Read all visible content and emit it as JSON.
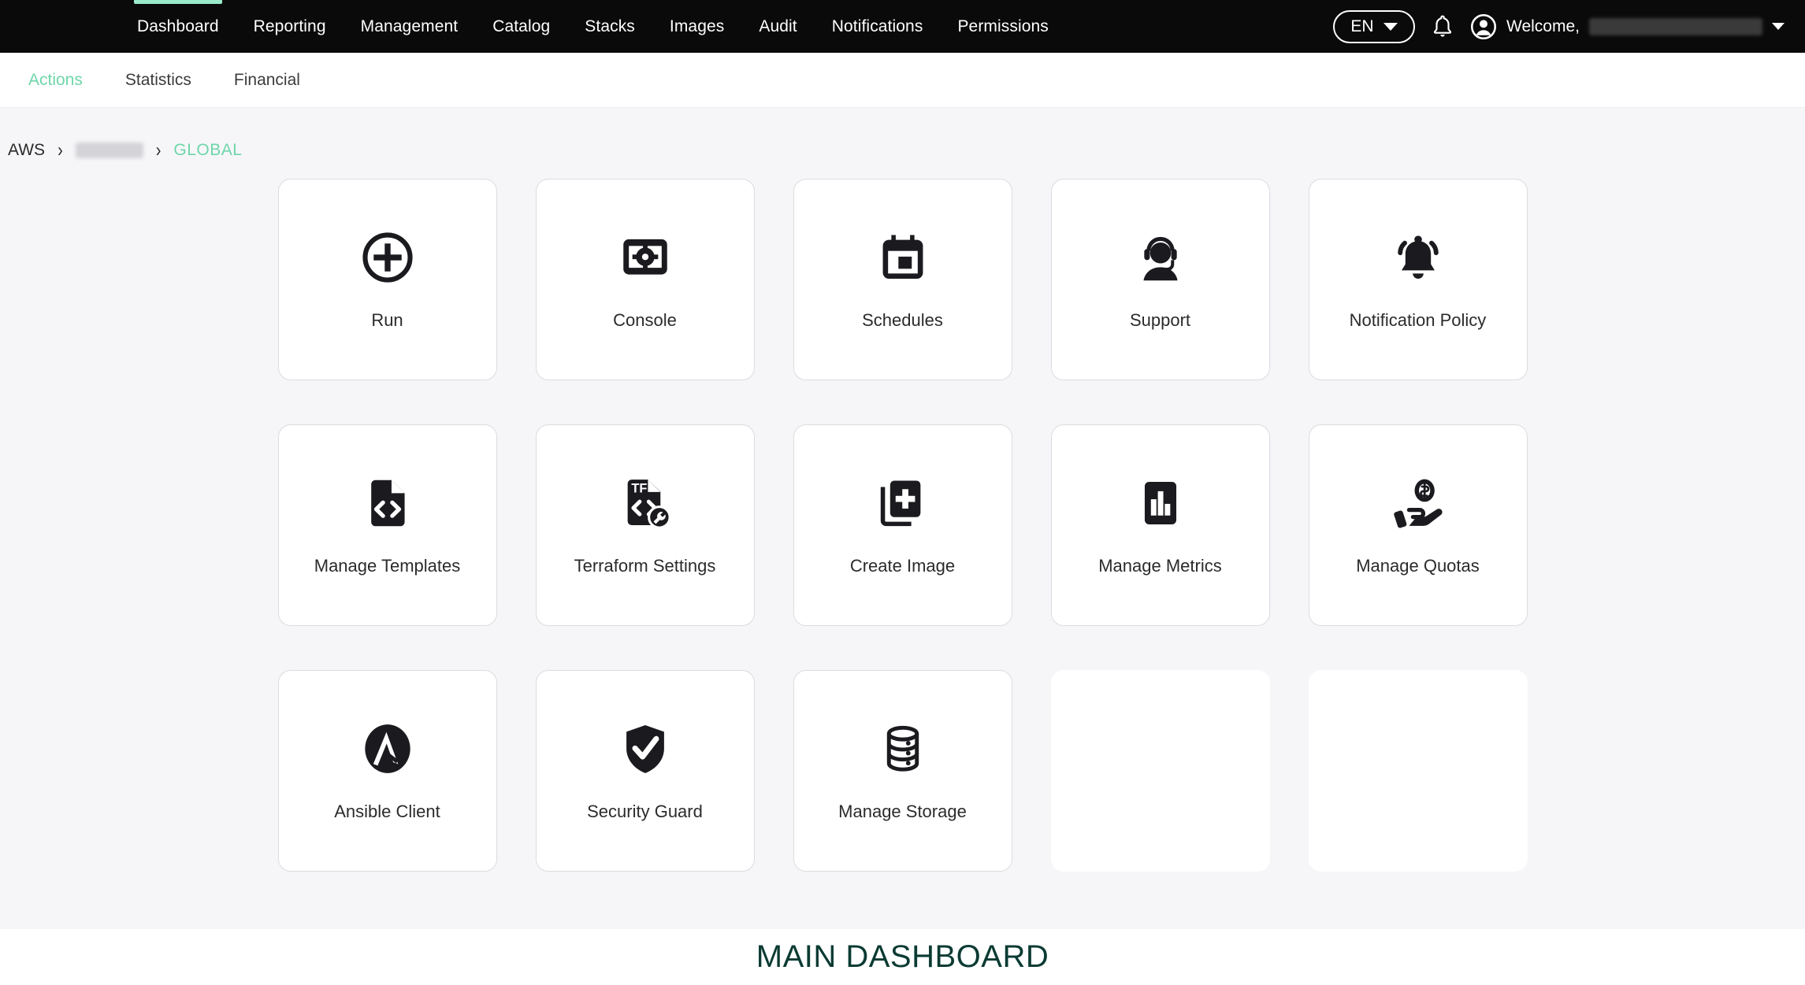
{
  "topnav": {
    "items": [
      {
        "label": "Dashboard",
        "active": true
      },
      {
        "label": "Reporting",
        "active": false
      },
      {
        "label": "Management",
        "active": false
      },
      {
        "label": "Catalog",
        "active": false
      },
      {
        "label": "Stacks",
        "active": false
      },
      {
        "label": "Images",
        "active": false
      },
      {
        "label": "Audit",
        "active": false
      },
      {
        "label": "Notifications",
        "active": false
      },
      {
        "label": "Permissions",
        "active": false
      }
    ],
    "language": "EN",
    "welcome_label": "Welcome,",
    "user_name_redacted": true,
    "icons": {
      "bell": "bell-icon",
      "user": "user-avatar-icon",
      "lang_chevron": "chevron-down-icon",
      "user_chevron": "chevron-down-icon"
    }
  },
  "subnav": {
    "items": [
      {
        "label": "Actions",
        "active": true
      },
      {
        "label": "Statistics",
        "active": false
      },
      {
        "label": "Financial",
        "active": false
      }
    ],
    "active_color": "#6fd6aa"
  },
  "breadcrumb": {
    "separator": "›",
    "items": [
      {
        "label": "AWS",
        "type": "text"
      },
      {
        "label": "",
        "type": "redacted"
      },
      {
        "label": "GLOBAL",
        "type": "accent"
      }
    ]
  },
  "cards": [
    {
      "label": "Run",
      "icon": "plus-circle-icon",
      "empty": false
    },
    {
      "label": "Console",
      "icon": "monitor-gear-icon",
      "empty": false
    },
    {
      "label": "Schedules",
      "icon": "calendar-icon",
      "empty": false
    },
    {
      "label": "Support",
      "icon": "headset-agent-icon",
      "empty": false
    },
    {
      "label": "Notification Policy",
      "icon": "ringing-bell-icon",
      "empty": false
    },
    {
      "label": "Manage Templates",
      "icon": "code-file-icon",
      "empty": false
    },
    {
      "label": "Terraform Settings",
      "icon": "terraform-file-wrench-icon",
      "empty": false
    },
    {
      "label": "Create Image",
      "icon": "copy-plus-icon",
      "empty": false
    },
    {
      "label": "Manage Metrics",
      "icon": "bar-chart-icon",
      "empty": false
    },
    {
      "label": "Manage Quotas",
      "icon": "hand-coin-icon",
      "empty": false
    },
    {
      "label": "Ansible Client",
      "icon": "ansible-logo-icon",
      "empty": false
    },
    {
      "label": "Security Guard",
      "icon": "shield-check-icon",
      "empty": false
    },
    {
      "label": "Manage Storage",
      "icon": "database-stack-icon",
      "empty": false
    },
    {
      "label": "",
      "icon": "",
      "empty": true
    },
    {
      "label": "",
      "icon": "",
      "empty": true
    }
  ],
  "footer": {
    "caption": "MAIN DASHBOARD",
    "caption_color": "#0b3b33"
  },
  "colors": {
    "topnav_bg": "#0a0a0a",
    "accent_mint": "#9ae9cb",
    "accent_green": "#6fd6aa",
    "page_bg": "#f6f6f8",
    "card_bg": "#ffffff",
    "card_border": "#dcdce0"
  }
}
